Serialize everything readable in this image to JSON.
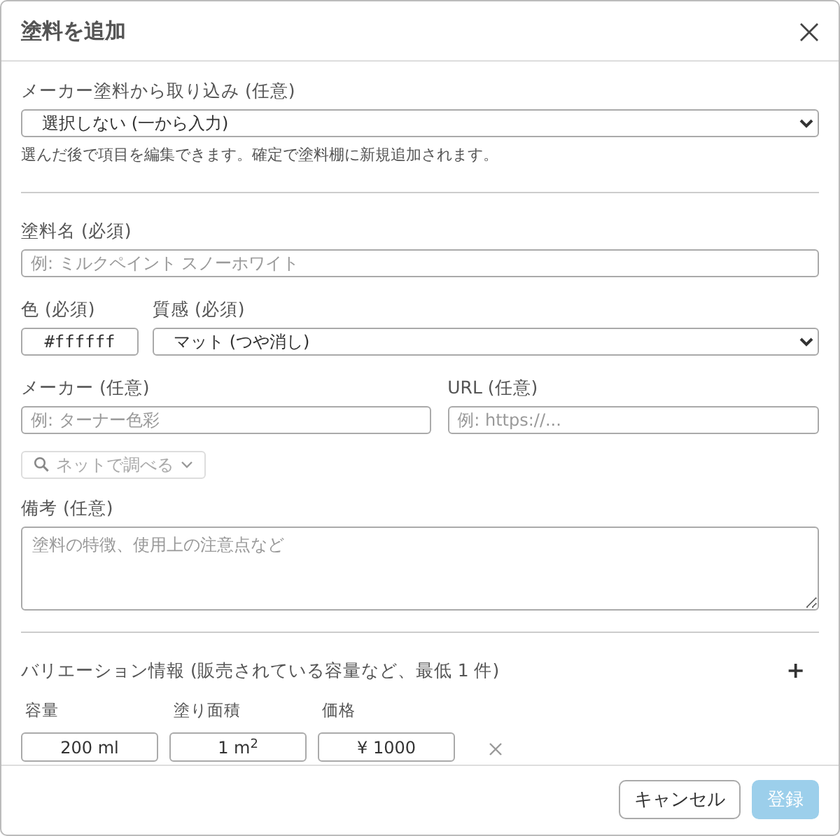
{
  "dialog": {
    "title": "塗料を追加"
  },
  "import": {
    "label": "メーカー塗料から取り込み (任意)",
    "value": "選択しない (一から入力)",
    "help": "選んだ後で項目を編集できます。確定で塗料棚に新規追加されます。"
  },
  "name": {
    "label": "塗料名 (必須)",
    "placeholder": "例: ミルクペイント スノーホワイト"
  },
  "color": {
    "label": "色 (必須)",
    "value": "#ffffff"
  },
  "finish": {
    "label": "質感 (必須)",
    "value": "マット (つや消し)"
  },
  "maker": {
    "label": "メーカー (任意)",
    "placeholder": "例: ターナー色彩"
  },
  "url": {
    "label": "URL (任意)",
    "placeholder": "例: https://..."
  },
  "search_button": {
    "label": "ネットで調べる",
    "disabled": true
  },
  "notes": {
    "label": "備考 (任意)",
    "placeholder": "塗料の特徴、使用上の注意点など"
  },
  "variations": {
    "title": "バリエーション情報 (販売されている容量など、最低 1 件)",
    "add_button": "+",
    "columns": [
      "容量",
      "塗り面積",
      "価格"
    ],
    "rows": [
      {
        "values": [
          "200 ml",
          "1 m$^{2}$",
          "¥ 1000"
        ]
      }
    ]
  },
  "footer": {
    "buttons": [
      {
        "label": "キャンセル",
        "kind": "secondary",
        "disabled": false
      },
      {
        "label": "登録",
        "kind": "primary",
        "disabled": true
      }
    ]
  }
}
